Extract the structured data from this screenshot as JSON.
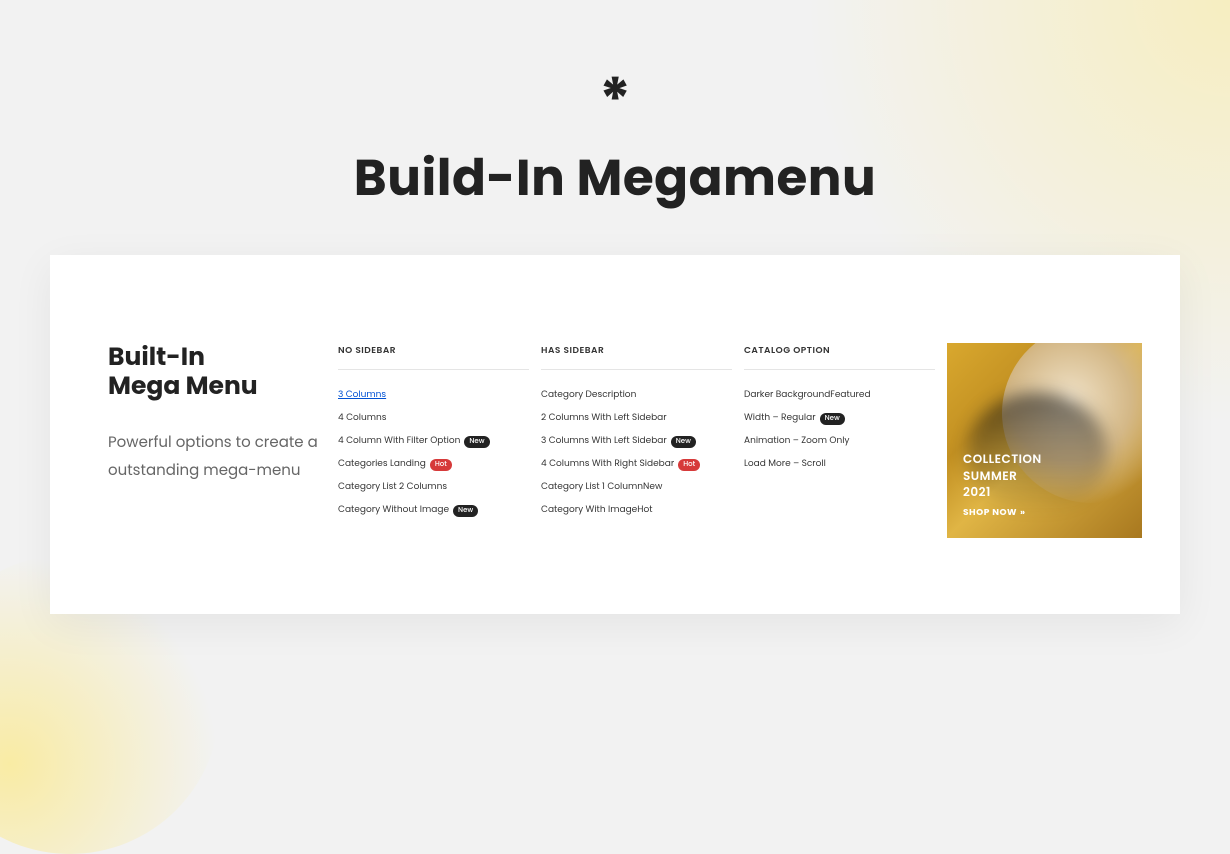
{
  "header": {
    "icon": "*",
    "title": "Build-In Megamenu"
  },
  "sidebar": {
    "title_line1": "Built-In",
    "title_line2": "Mega Menu",
    "description": "Powerful options to create a outstanding mega-menu"
  },
  "columns": [
    {
      "header": "NO SIDEBAR",
      "items": [
        {
          "label": "3 Columns",
          "badge": null,
          "active": true
        },
        {
          "label": "4 Columns",
          "badge": null
        },
        {
          "label": "4 Column With Filter Option",
          "badge": "New"
        },
        {
          "label": "Categories Landing",
          "badge": "Hot"
        },
        {
          "label": "Category List 2 Columns",
          "badge": null
        },
        {
          "label": "Category Without Image",
          "badge": "New"
        }
      ]
    },
    {
      "header": "HAS SIDEBAR",
      "items": [
        {
          "label": "Category Description",
          "badge": null
        },
        {
          "label": "2 Columns With Left Sidebar",
          "badge": null
        },
        {
          "label": "3 Columns With Left Sidebar",
          "badge": "New"
        },
        {
          "label": "4 Columns With Right Sidebar",
          "badge": "Hot"
        },
        {
          "label": "Category List 1 Column",
          "inline": "New"
        },
        {
          "label": "Category With Image",
          "inline": "Hot"
        }
      ]
    },
    {
      "header": "CATALOG OPTION",
      "items": [
        {
          "label": "Darker Background",
          "inline": "Featured"
        },
        {
          "label": "Width – Regular",
          "badge": "New"
        },
        {
          "label": "Animation – Zoom Only",
          "badge": null
        },
        {
          "label": "Load More – Scroll",
          "badge": null
        }
      ]
    }
  ],
  "promo": {
    "line1": "COLLECTION",
    "line2": "SUMMER",
    "line3": "2021",
    "button": "SHOP NOW"
  }
}
